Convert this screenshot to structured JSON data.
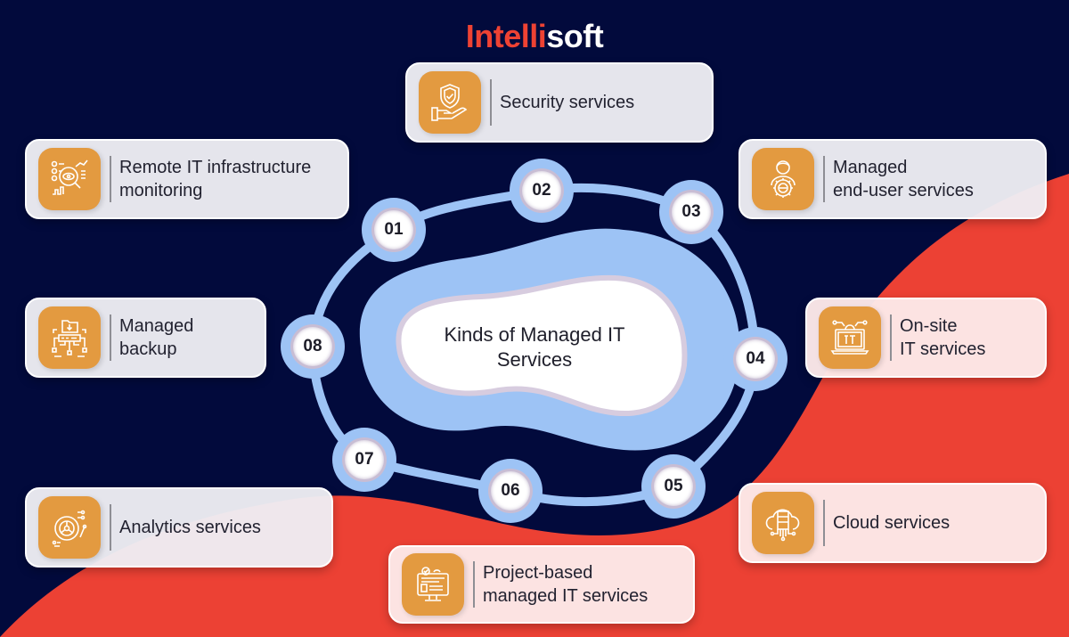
{
  "brand": {
    "part1": "Intelli",
    "part2": "soft"
  },
  "colors": {
    "background": "#020a3c",
    "accent_red": "#ee4233",
    "ring_blue": "#9dc3f5",
    "icon_orange": "#e39a40"
  },
  "center": {
    "line1": "Kinds of Managed IT",
    "line2": "Services"
  },
  "steps": [
    {
      "number": "01",
      "lines": [
        "Remote IT infrastructure",
        "monitoring"
      ],
      "icon": "monitoring-icon"
    },
    {
      "number": "02",
      "lines": [
        "Security services"
      ],
      "icon": "shield-hand-icon"
    },
    {
      "number": "03",
      "lines": [
        "Managed",
        "end-user services"
      ],
      "icon": "user-gear-icon"
    },
    {
      "number": "04",
      "lines": [
        "On-site",
        "IT services"
      ],
      "icon": "laptop-it-icon"
    },
    {
      "number": "05",
      "lines": [
        "Cloud services"
      ],
      "icon": "cloud-server-icon"
    },
    {
      "number": "06",
      "lines": [
        "Project-based",
        "managed IT services"
      ],
      "icon": "monitor-project-icon"
    },
    {
      "number": "07",
      "lines": [
        "Analytics services"
      ],
      "icon": "analytics-icon"
    },
    {
      "number": "08",
      "lines": [
        "Managed",
        "backup"
      ],
      "icon": "backup-network-icon"
    }
  ]
}
